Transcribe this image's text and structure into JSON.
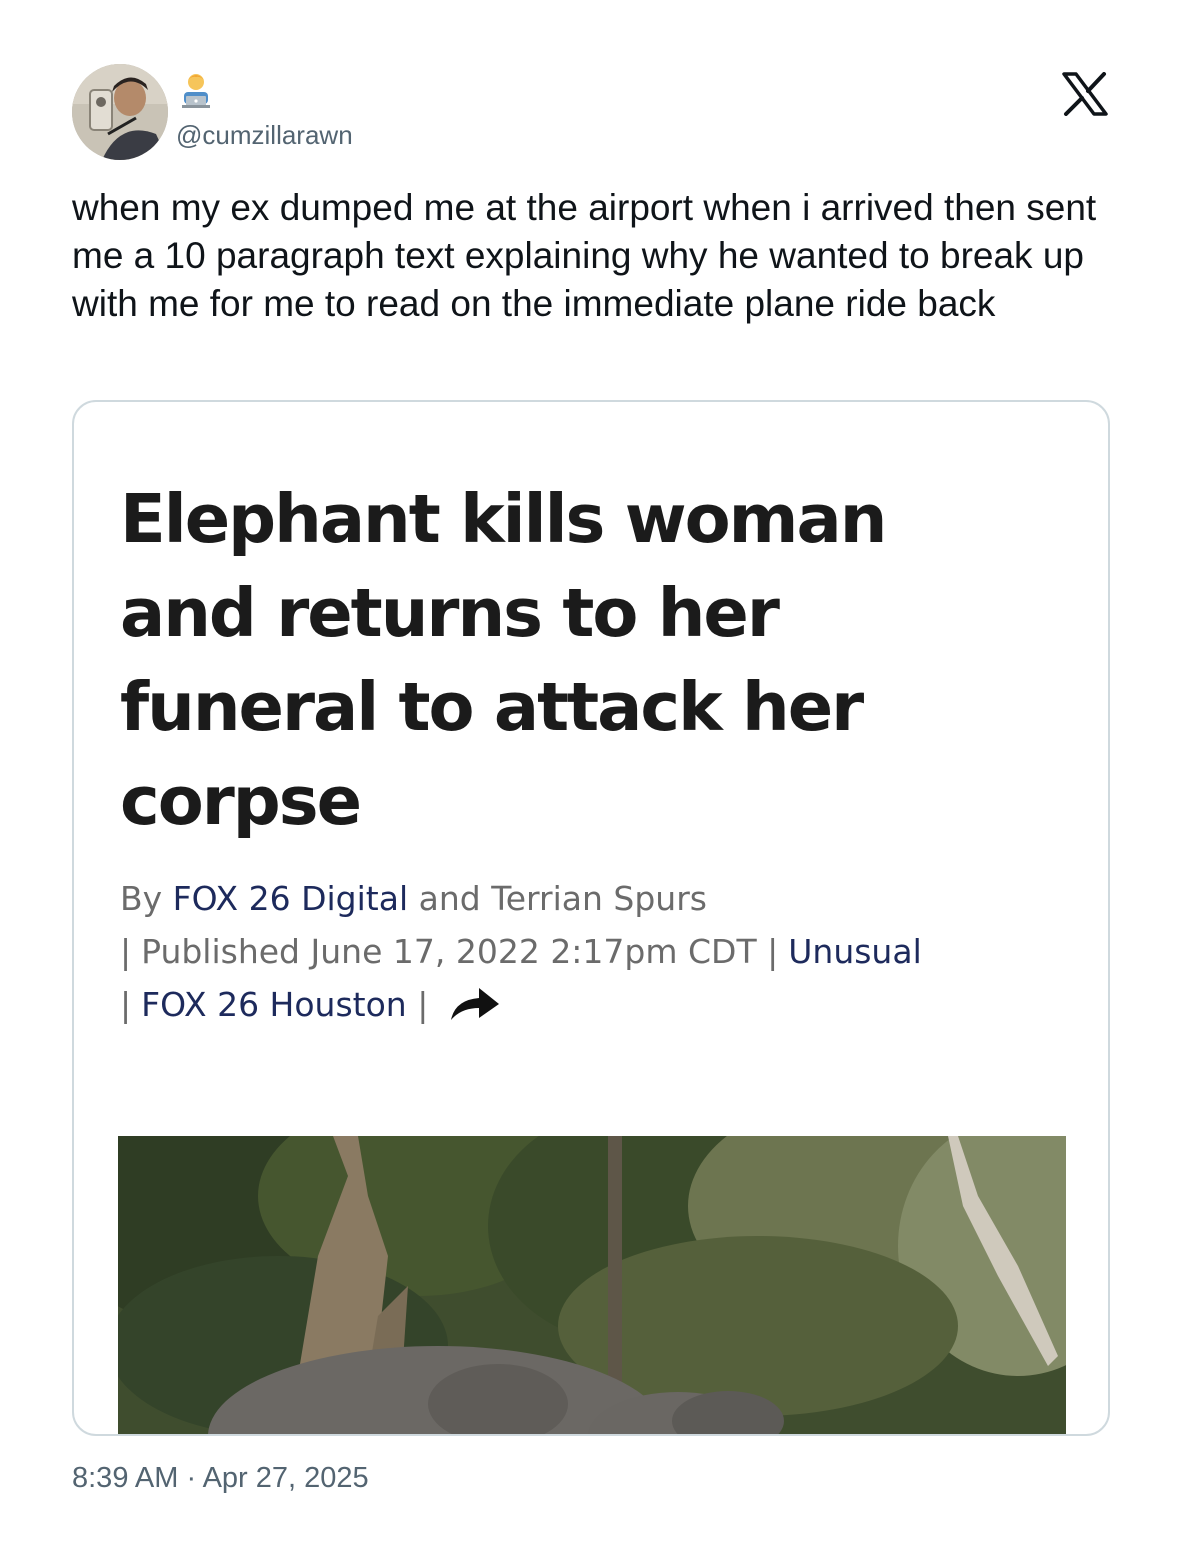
{
  "tweet": {
    "handle": "@cumzillarawn",
    "text": "when my ex dumped me at the airport when i arrived then sent me a 10 paragraph text explaining why he wanted to break up with me for me to read on the immediate plane ride back",
    "timestamp": "8:39 AM · Apr 27, 2025"
  },
  "card": {
    "headline": "Elephant kills woman and returns to her funeral to attack her corpse",
    "byline": {
      "by": "By",
      "author1": "FOX 26 Digital",
      "and": "and Terrian Spurs",
      "sep": "|",
      "published": "Published",
      "date": "June 17, 2022 2:17pm CDT",
      "category": "Unusual",
      "station": "FOX 26 Houston"
    }
  },
  "icons": {
    "avatar": "avatar-photo",
    "badge": "technologist-emoji-icon",
    "logo": "x-logo-icon",
    "share": "share-arrow-icon"
  },
  "colors": {
    "text": "#0f1419",
    "secondary": "#536471",
    "border": "#cfd9de",
    "byline_link": "#1d2a5c"
  }
}
